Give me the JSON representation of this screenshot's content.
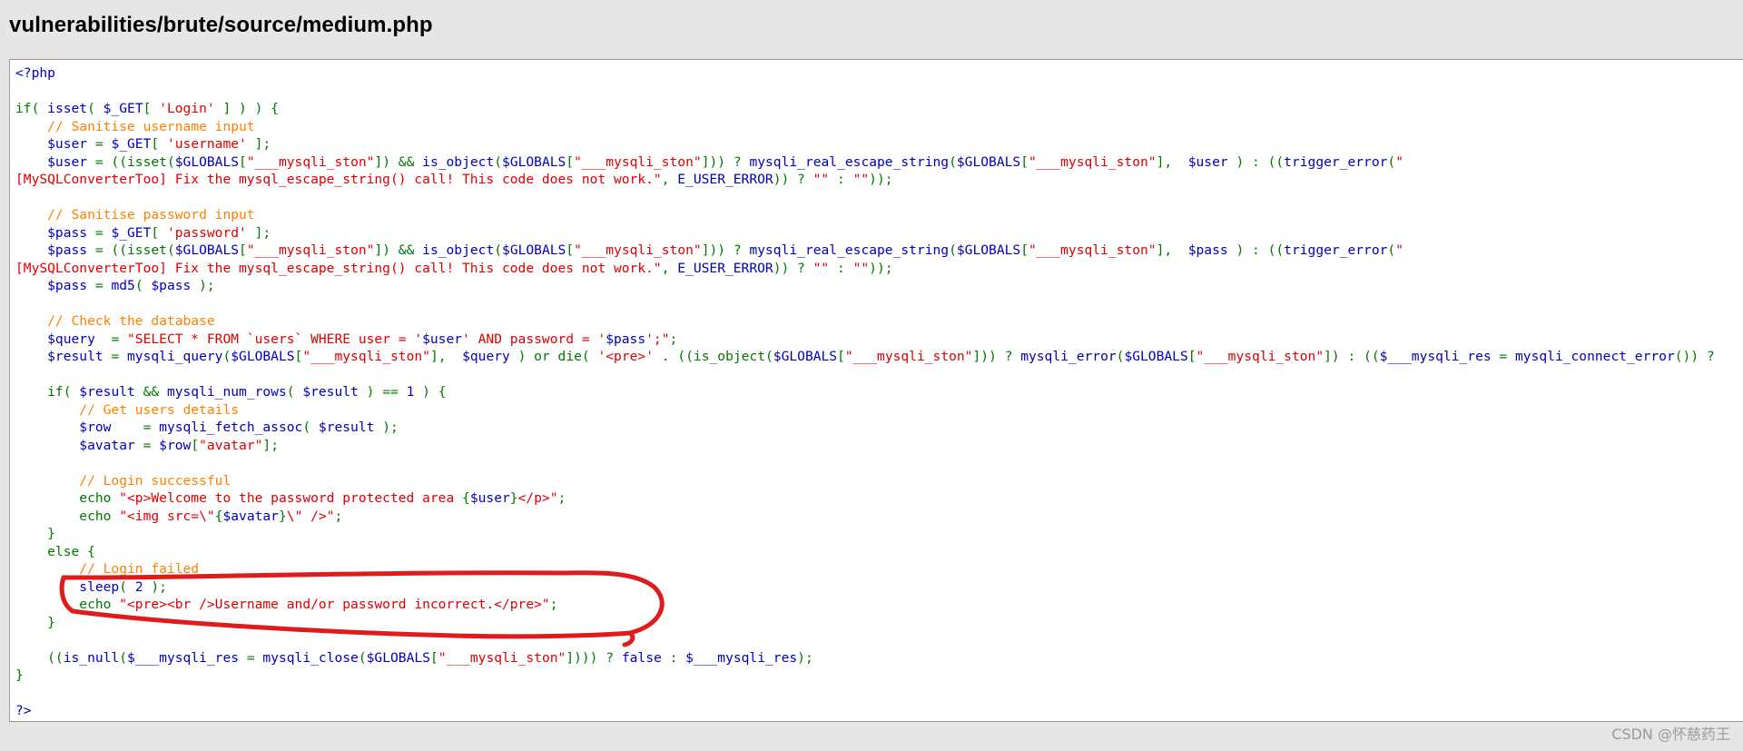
{
  "page": {
    "title": "vulnerabilities/brute/source/medium.php"
  },
  "code": {
    "lines": [
      [
        {
          "t": "v",
          "s": "<?php"
        }
      ],
      [],
      [
        {
          "t": "k",
          "s": "if( "
        },
        {
          "t": "v",
          "s": "isset"
        },
        {
          "t": "k",
          "s": "( "
        },
        {
          "t": "v",
          "s": "$_GET"
        },
        {
          "t": "k",
          "s": "[ "
        },
        {
          "t": "s",
          "s": "'Login'"
        },
        {
          "t": "k",
          "s": " ] ) ) {"
        }
      ],
      [
        {
          "t": "c",
          "s": "    // Sanitise username input"
        }
      ],
      [
        {
          "t": "v",
          "s": "    $user "
        },
        {
          "t": "k",
          "s": "= "
        },
        {
          "t": "v",
          "s": "$_GET"
        },
        {
          "t": "k",
          "s": "[ "
        },
        {
          "t": "s",
          "s": "'username'"
        },
        {
          "t": "k",
          "s": " ];"
        }
      ],
      [
        {
          "t": "v",
          "s": "    $user "
        },
        {
          "t": "k",
          "s": "= ((isset("
        },
        {
          "t": "v",
          "s": "$GLOBALS"
        },
        {
          "t": "k",
          "s": "["
        },
        {
          "t": "s",
          "s": "\"___mysqli_ston\""
        },
        {
          "t": "k",
          "s": "]) && "
        },
        {
          "t": "v",
          "s": "is_object"
        },
        {
          "t": "k",
          "s": "("
        },
        {
          "t": "v",
          "s": "$GLOBALS"
        },
        {
          "t": "k",
          "s": "["
        },
        {
          "t": "s",
          "s": "\"___mysqli_ston\""
        },
        {
          "t": "k",
          "s": "])) ? "
        },
        {
          "t": "v",
          "s": "mysqli_real_escape_string"
        },
        {
          "t": "k",
          "s": "("
        },
        {
          "t": "v",
          "s": "$GLOBALS"
        },
        {
          "t": "k",
          "s": "["
        },
        {
          "t": "s",
          "s": "\"___mysqli_ston\""
        },
        {
          "t": "k",
          "s": "],  "
        },
        {
          "t": "v",
          "s": "$user "
        },
        {
          "t": "k",
          "s": ") : (("
        },
        {
          "t": "v",
          "s": "trigger_error"
        },
        {
          "t": "k",
          "s": "("
        },
        {
          "t": "s",
          "s": "\""
        }
      ],
      [
        {
          "t": "s",
          "s": "[MySQLConverterToo] Fix the mysql_escape_string() call! This code does not work.\""
        },
        {
          "t": "k",
          "s": ", "
        },
        {
          "t": "v",
          "s": "E_USER_ERROR"
        },
        {
          "t": "k",
          "s": ")) ? "
        },
        {
          "t": "s",
          "s": "\"\""
        },
        {
          "t": "k",
          "s": " : "
        },
        {
          "t": "s",
          "s": "\"\""
        },
        {
          "t": "k",
          "s": "));"
        }
      ],
      [],
      [
        {
          "t": "c",
          "s": "    // Sanitise password input"
        }
      ],
      [
        {
          "t": "v",
          "s": "    $pass "
        },
        {
          "t": "k",
          "s": "= "
        },
        {
          "t": "v",
          "s": "$_GET"
        },
        {
          "t": "k",
          "s": "[ "
        },
        {
          "t": "s",
          "s": "'password'"
        },
        {
          "t": "k",
          "s": " ];"
        }
      ],
      [
        {
          "t": "v",
          "s": "    $pass "
        },
        {
          "t": "k",
          "s": "= ((isset("
        },
        {
          "t": "v",
          "s": "$GLOBALS"
        },
        {
          "t": "k",
          "s": "["
        },
        {
          "t": "s",
          "s": "\"___mysqli_ston\""
        },
        {
          "t": "k",
          "s": "]) && "
        },
        {
          "t": "v",
          "s": "is_object"
        },
        {
          "t": "k",
          "s": "("
        },
        {
          "t": "v",
          "s": "$GLOBALS"
        },
        {
          "t": "k",
          "s": "["
        },
        {
          "t": "s",
          "s": "\"___mysqli_ston\""
        },
        {
          "t": "k",
          "s": "])) ? "
        },
        {
          "t": "v",
          "s": "mysqli_real_escape_string"
        },
        {
          "t": "k",
          "s": "("
        },
        {
          "t": "v",
          "s": "$GLOBALS"
        },
        {
          "t": "k",
          "s": "["
        },
        {
          "t": "s",
          "s": "\"___mysqli_ston\""
        },
        {
          "t": "k",
          "s": "],  "
        },
        {
          "t": "v",
          "s": "$pass "
        },
        {
          "t": "k",
          "s": ") : (("
        },
        {
          "t": "v",
          "s": "trigger_error"
        },
        {
          "t": "k",
          "s": "("
        },
        {
          "t": "s",
          "s": "\""
        }
      ],
      [
        {
          "t": "s",
          "s": "[MySQLConverterToo] Fix the mysql_escape_string() call! This code does not work.\""
        },
        {
          "t": "k",
          "s": ", "
        },
        {
          "t": "v",
          "s": "E_USER_ERROR"
        },
        {
          "t": "k",
          "s": ")) ? "
        },
        {
          "t": "s",
          "s": "\"\""
        },
        {
          "t": "k",
          "s": " : "
        },
        {
          "t": "s",
          "s": "\"\""
        },
        {
          "t": "k",
          "s": "));"
        }
      ],
      [
        {
          "t": "v",
          "s": "    $pass "
        },
        {
          "t": "k",
          "s": "= "
        },
        {
          "t": "v",
          "s": "md5"
        },
        {
          "t": "k",
          "s": "( "
        },
        {
          "t": "v",
          "s": "$pass "
        },
        {
          "t": "k",
          "s": ");"
        }
      ],
      [],
      [
        {
          "t": "c",
          "s": "    // Check the database"
        }
      ],
      [
        {
          "t": "v",
          "s": "    $query  "
        },
        {
          "t": "k",
          "s": "= "
        },
        {
          "t": "s",
          "s": "\"SELECT * FROM `users` WHERE user = '"
        },
        {
          "t": "v",
          "s": "$user"
        },
        {
          "t": "s",
          "s": "' AND password = '"
        },
        {
          "t": "v",
          "s": "$pass"
        },
        {
          "t": "s",
          "s": "';\""
        },
        {
          "t": "k",
          "s": ";"
        }
      ],
      [
        {
          "t": "v",
          "s": "    $result "
        },
        {
          "t": "k",
          "s": "= "
        },
        {
          "t": "v",
          "s": "mysqli_query"
        },
        {
          "t": "k",
          "s": "("
        },
        {
          "t": "v",
          "s": "$GLOBALS"
        },
        {
          "t": "k",
          "s": "["
        },
        {
          "t": "s",
          "s": "\"___mysqli_ston\""
        },
        {
          "t": "k",
          "s": "],  "
        },
        {
          "t": "v",
          "s": "$query "
        },
        {
          "t": "k",
          "s": ") or die( "
        },
        {
          "t": "s",
          "s": "'<pre>'"
        },
        {
          "t": "k",
          "s": " . ((is_object("
        },
        {
          "t": "v",
          "s": "$GLOBALS"
        },
        {
          "t": "k",
          "s": "["
        },
        {
          "t": "s",
          "s": "\"___mysqli_ston\""
        },
        {
          "t": "k",
          "s": "])) ? "
        },
        {
          "t": "v",
          "s": "mysqli_error"
        },
        {
          "t": "k",
          "s": "("
        },
        {
          "t": "v",
          "s": "$GLOBALS"
        },
        {
          "t": "k",
          "s": "["
        },
        {
          "t": "s",
          "s": "\"___mysqli_ston\""
        },
        {
          "t": "k",
          "s": "]) : (("
        },
        {
          "t": "v",
          "s": "$___mysqli_res "
        },
        {
          "t": "k",
          "s": "= "
        },
        {
          "t": "v",
          "s": "mysqli_connect_error"
        },
        {
          "t": "k",
          "s": "()) ? "
        }
      ],
      [],
      [
        {
          "t": "k",
          "s": "    if( "
        },
        {
          "t": "v",
          "s": "$result "
        },
        {
          "t": "k",
          "s": "&& "
        },
        {
          "t": "v",
          "s": "mysqli_num_rows"
        },
        {
          "t": "k",
          "s": "( "
        },
        {
          "t": "v",
          "s": "$result "
        },
        {
          "t": "k",
          "s": ") == "
        },
        {
          "t": "v",
          "s": "1 "
        },
        {
          "t": "k",
          "s": ") {"
        }
      ],
      [
        {
          "t": "c",
          "s": "        // Get users details"
        }
      ],
      [
        {
          "t": "v",
          "s": "        $row    "
        },
        {
          "t": "k",
          "s": "= "
        },
        {
          "t": "v",
          "s": "mysqli_fetch_assoc"
        },
        {
          "t": "k",
          "s": "( "
        },
        {
          "t": "v",
          "s": "$result "
        },
        {
          "t": "k",
          "s": ");"
        }
      ],
      [
        {
          "t": "v",
          "s": "        $avatar "
        },
        {
          "t": "k",
          "s": "= "
        },
        {
          "t": "v",
          "s": "$row"
        },
        {
          "t": "k",
          "s": "["
        },
        {
          "t": "s",
          "s": "\"avatar\""
        },
        {
          "t": "k",
          "s": "];"
        }
      ],
      [],
      [
        {
          "t": "c",
          "s": "        // Login successful"
        }
      ],
      [
        {
          "t": "k",
          "s": "        echo "
        },
        {
          "t": "s",
          "s": "\"<p>Welcome to the password protected area "
        },
        {
          "t": "k",
          "s": "{"
        },
        {
          "t": "v",
          "s": "$user"
        },
        {
          "t": "k",
          "s": "}"
        },
        {
          "t": "s",
          "s": "</p>\""
        },
        {
          "t": "k",
          "s": ";"
        }
      ],
      [
        {
          "t": "k",
          "s": "        echo "
        },
        {
          "t": "s",
          "s": "\"<img src=\\\""
        },
        {
          "t": "k",
          "s": "{"
        },
        {
          "t": "v",
          "s": "$avatar"
        },
        {
          "t": "k",
          "s": "}"
        },
        {
          "t": "s",
          "s": "\\\" />\""
        },
        {
          "t": "k",
          "s": ";"
        }
      ],
      [
        {
          "t": "k",
          "s": "    }"
        }
      ],
      [
        {
          "t": "k",
          "s": "    else {"
        }
      ],
      [
        {
          "t": "c",
          "s": "        // Login failed"
        }
      ],
      [
        {
          "t": "v",
          "s": "        sleep"
        },
        {
          "t": "k",
          "s": "( "
        },
        {
          "t": "v",
          "s": "2 "
        },
        {
          "t": "k",
          "s": ");"
        }
      ],
      [
        {
          "t": "k",
          "s": "        echo "
        },
        {
          "t": "s",
          "s": "\"<pre><br />Username and/or password incorrect.</pre>\""
        },
        {
          "t": "k",
          "s": ";"
        }
      ],
      [
        {
          "t": "k",
          "s": "    }"
        }
      ],
      [],
      [
        {
          "t": "k",
          "s": "    (("
        },
        {
          "t": "v",
          "s": "is_null"
        },
        {
          "t": "k",
          "s": "("
        },
        {
          "t": "v",
          "s": "$___mysqli_res "
        },
        {
          "t": "k",
          "s": "= "
        },
        {
          "t": "v",
          "s": "mysqli_close"
        },
        {
          "t": "k",
          "s": "("
        },
        {
          "t": "v",
          "s": "$GLOBALS"
        },
        {
          "t": "k",
          "s": "["
        },
        {
          "t": "s",
          "s": "\"___mysqli_ston\""
        },
        {
          "t": "k",
          "s": "]))) ? "
        },
        {
          "t": "v",
          "s": "false "
        },
        {
          "t": "k",
          "s": ": "
        },
        {
          "t": "v",
          "s": "$___mysqli_res"
        },
        {
          "t": "k",
          "s": ");"
        }
      ],
      [
        {
          "t": "k",
          "s": "}"
        }
      ],
      [],
      [
        {
          "t": "v",
          "s": "?>"
        }
      ]
    ]
  },
  "colors": {
    "keyword": "#007700",
    "default": "#0000bb",
    "string": "#dd0000",
    "comment": "#ff8000",
    "annotation_stroke": "#e01b1b"
  },
  "annotation": {
    "shape": "hand-drawn-ellipse",
    "target": "sleep( 2 ); echo \"<pre><br />Username and/or password incorrect.</pre>\";"
  },
  "watermark": {
    "text": "CSDN @怀慈药王"
  }
}
